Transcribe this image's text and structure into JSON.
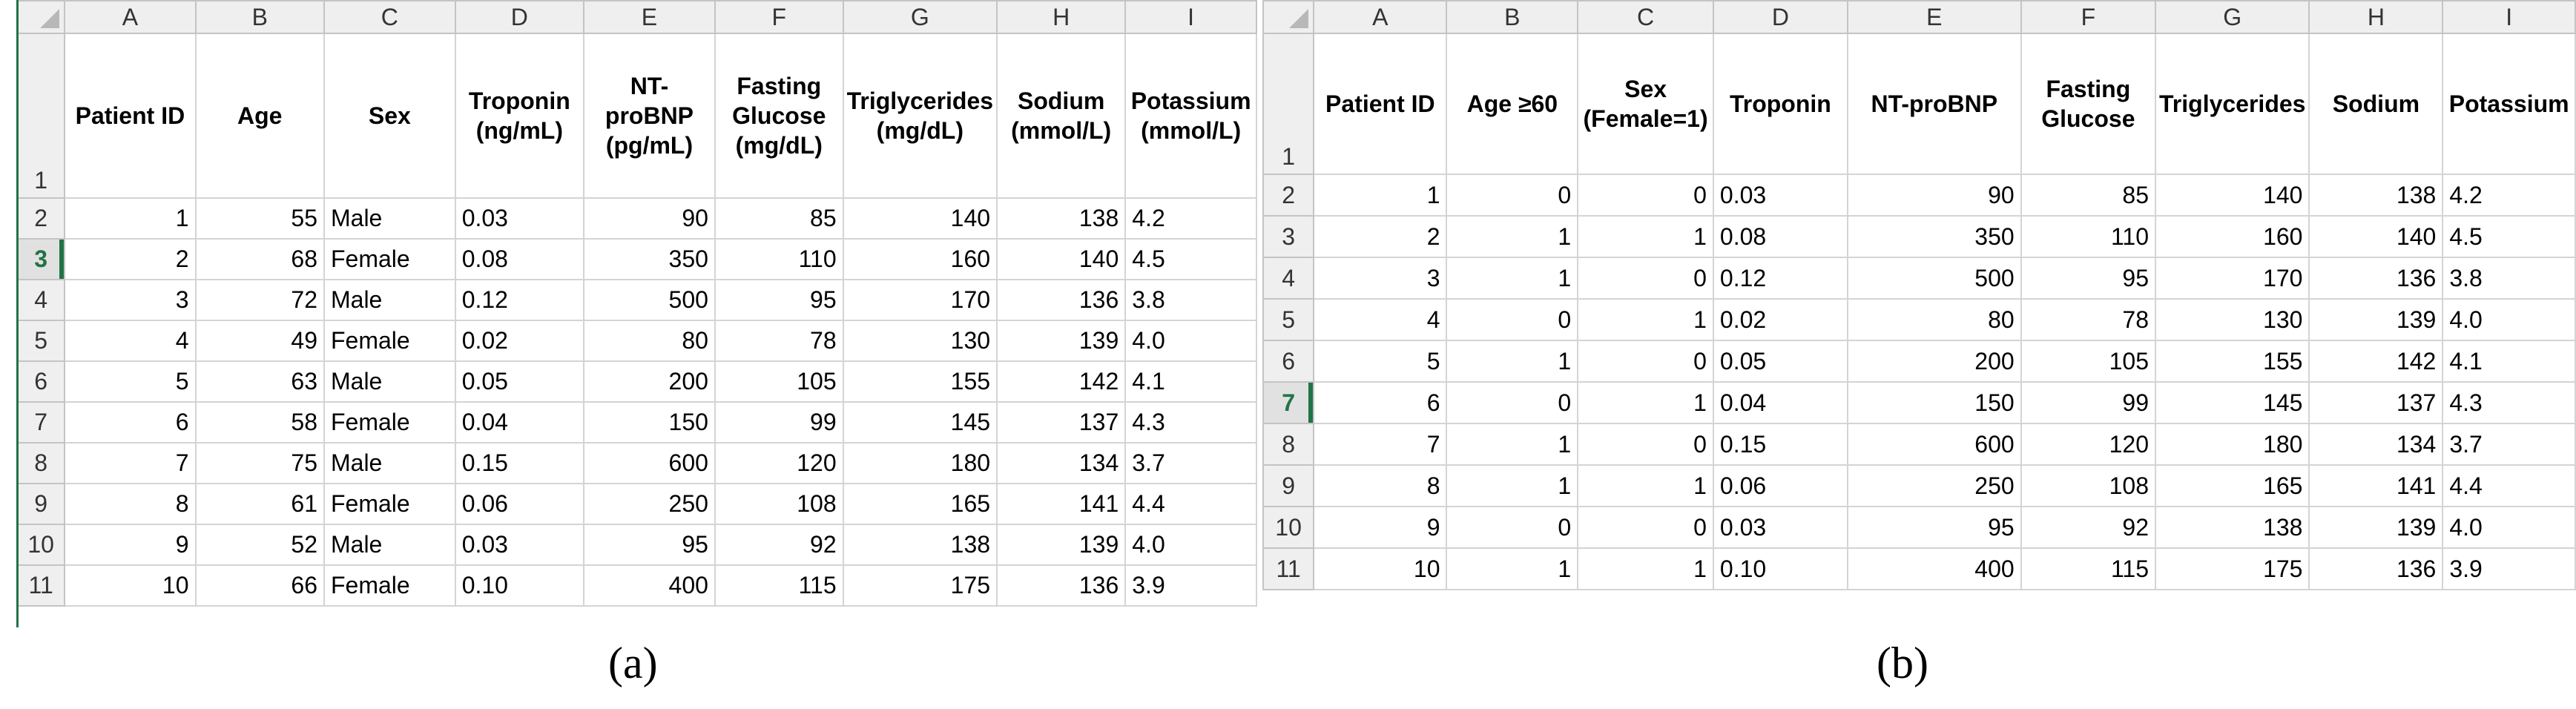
{
  "sheet_a": {
    "columns": [
      "A",
      "B",
      "C",
      "D",
      "E",
      "F",
      "G",
      "H",
      "I"
    ],
    "headers": [
      "Patient ID",
      "Age",
      "Sex",
      "Troponin (ng/mL)",
      "NT-proBNP (pg/mL)",
      "Fasting Glucose (mg/dL)",
      "Triglycerides (mg/dL)",
      "Sodium (mmol/L)",
      "Potassium (mmol/L)"
    ],
    "selected_row": "3",
    "rows": [
      {
        "n": "2",
        "c": [
          "1",
          "55",
          "Male",
          "0.03",
          "90",
          "85",
          "140",
          "138",
          "4.2"
        ]
      },
      {
        "n": "3",
        "c": [
          "2",
          "68",
          "Female",
          "0.08",
          "350",
          "110",
          "160",
          "140",
          "4.5"
        ]
      },
      {
        "n": "4",
        "c": [
          "3",
          "72",
          "Male",
          "0.12",
          "500",
          "95",
          "170",
          "136",
          "3.8"
        ]
      },
      {
        "n": "5",
        "c": [
          "4",
          "49",
          "Female",
          "0.02",
          "80",
          "78",
          "130",
          "139",
          "4.0"
        ]
      },
      {
        "n": "6",
        "c": [
          "5",
          "63",
          "Male",
          "0.05",
          "200",
          "105",
          "155",
          "142",
          "4.1"
        ]
      },
      {
        "n": "7",
        "c": [
          "6",
          "58",
          "Female",
          "0.04",
          "150",
          "99",
          "145",
          "137",
          "4.3"
        ]
      },
      {
        "n": "8",
        "c": [
          "7",
          "75",
          "Male",
          "0.15",
          "600",
          "120",
          "180",
          "134",
          "3.7"
        ]
      },
      {
        "n": "9",
        "c": [
          "8",
          "61",
          "Female",
          "0.06",
          "250",
          "108",
          "165",
          "141",
          "4.4"
        ]
      },
      {
        "n": "10",
        "c": [
          "9",
          "52",
          "Male",
          "0.03",
          "95",
          "92",
          "138",
          "139",
          "4.0"
        ]
      },
      {
        "n": "11",
        "c": [
          "10",
          "66",
          "Female",
          "0.10",
          "400",
          "115",
          "175",
          "136",
          "3.9"
        ]
      }
    ],
    "caption": "(a)"
  },
  "sheet_b": {
    "columns": [
      "A",
      "B",
      "C",
      "D",
      "E",
      "F",
      "G",
      "H",
      "I"
    ],
    "headers": [
      "Patient ID",
      "Age ≥60",
      "Sex (Female=1)",
      "Troponin",
      "NT-proBNP",
      "Fasting Glucose",
      "Triglycerides",
      "Sodium",
      "Potassium"
    ],
    "selected_row": "7",
    "rows": [
      {
        "n": "2",
        "c": [
          "1",
          "0",
          "0",
          "0.03",
          "90",
          "85",
          "140",
          "138",
          "4.2"
        ]
      },
      {
        "n": "3",
        "c": [
          "2",
          "1",
          "1",
          "0.08",
          "350",
          "110",
          "160",
          "140",
          "4.5"
        ]
      },
      {
        "n": "4",
        "c": [
          "3",
          "1",
          "0",
          "0.12",
          "500",
          "95",
          "170",
          "136",
          "3.8"
        ]
      },
      {
        "n": "5",
        "c": [
          "4",
          "0",
          "1",
          "0.02",
          "80",
          "78",
          "130",
          "139",
          "4.0"
        ]
      },
      {
        "n": "6",
        "c": [
          "5",
          "1",
          "0",
          "0.05",
          "200",
          "105",
          "155",
          "142",
          "4.1"
        ]
      },
      {
        "n": "7",
        "c": [
          "6",
          "0",
          "1",
          "0.04",
          "150",
          "99",
          "145",
          "137",
          "4.3"
        ]
      },
      {
        "n": "8",
        "c": [
          "7",
          "1",
          "0",
          "0.15",
          "600",
          "120",
          "180",
          "134",
          "3.7"
        ]
      },
      {
        "n": "9",
        "c": [
          "8",
          "1",
          "1",
          "0.06",
          "250",
          "108",
          "165",
          "141",
          "4.4"
        ]
      },
      {
        "n": "10",
        "c": [
          "9",
          "0",
          "0",
          "0.03",
          "95",
          "92",
          "138",
          "139",
          "4.0"
        ]
      },
      {
        "n": "11",
        "c": [
          "10",
          "1",
          "1",
          "0.10",
          "400",
          "115",
          "175",
          "136",
          "3.9"
        ]
      }
    ],
    "caption": "(b)"
  },
  "colors": {
    "accent": "#217346",
    "grid": "#d4d4d4",
    "header_bg": "#efefef"
  }
}
